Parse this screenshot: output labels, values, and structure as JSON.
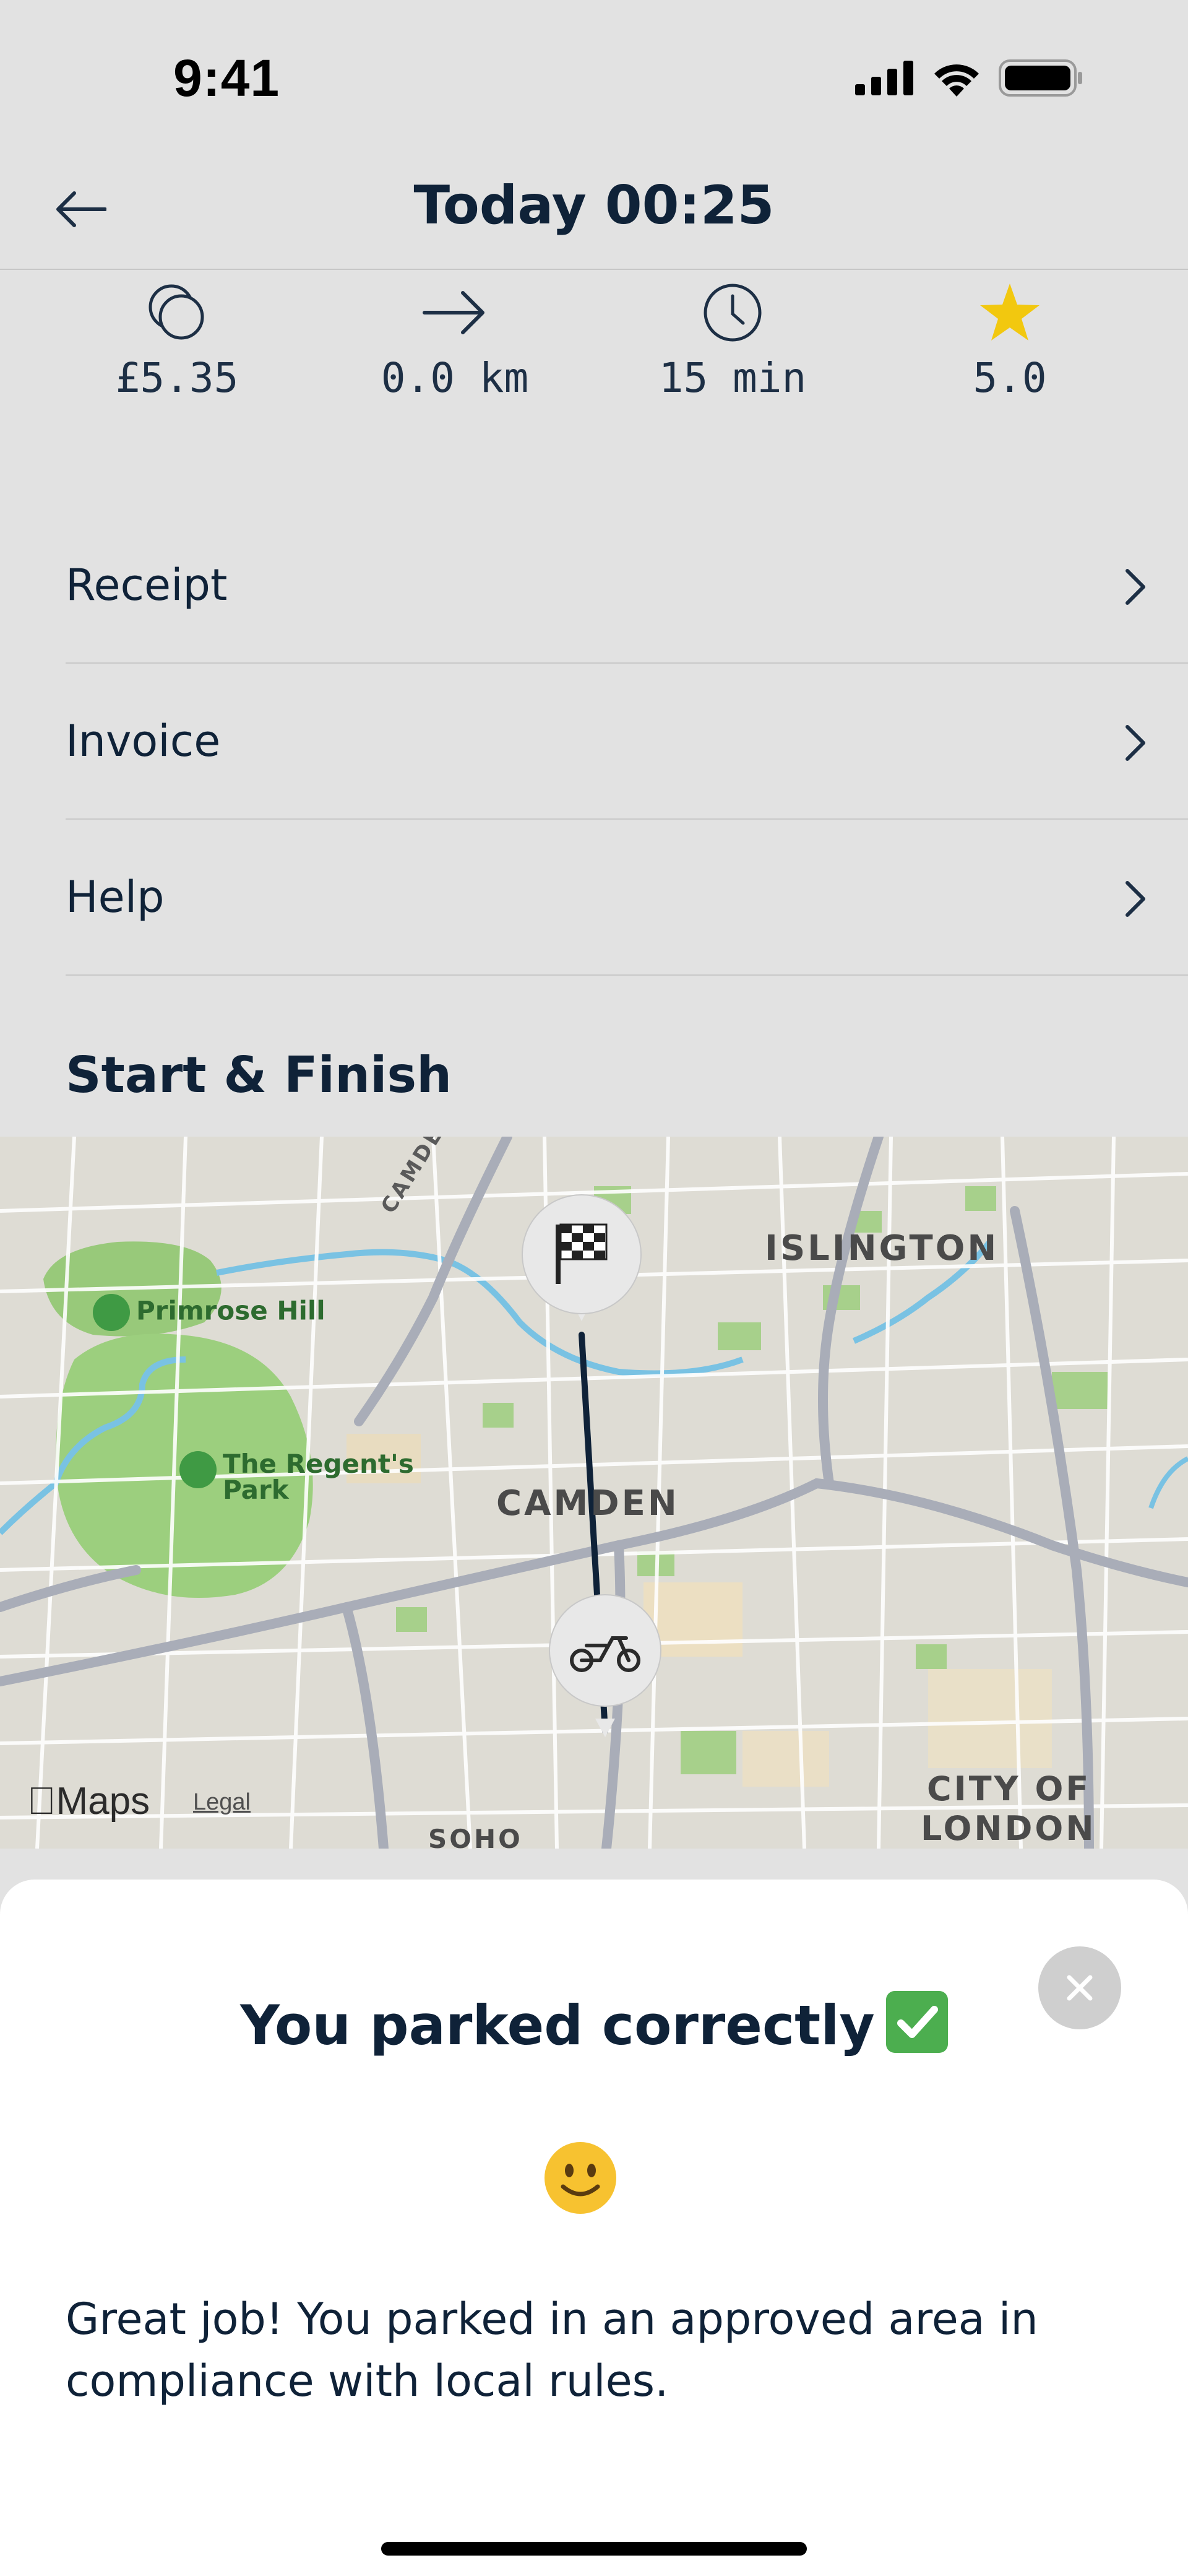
{
  "status_bar": {
    "time": "9:41"
  },
  "header": {
    "title": "Today 00:25"
  },
  "stats": [
    {
      "icon": "coins-icon",
      "value": "£5.35"
    },
    {
      "icon": "arrow-right-icon",
      "value": "0.0 km"
    },
    {
      "icon": "clock-icon",
      "value": "15 min"
    },
    {
      "icon": "star-icon",
      "value": "5.0"
    }
  ],
  "menu": [
    {
      "label": "Receipt"
    },
    {
      "label": "Invoice"
    },
    {
      "label": "Help"
    }
  ],
  "section": {
    "title": "Start & Finish"
  },
  "map": {
    "labels": {
      "islington": "ISLINGTON",
      "camden": "CAMDEN",
      "camden_road": "CAMDEN ROAD",
      "city_of_london_1": "CITY OF",
      "city_of_london_2": "LONDON",
      "soho": "SOHO",
      "primrose_hill": "Primrose Hill",
      "regents_park_1": "The Regent's",
      "regents_park_2": "Park"
    },
    "logo": "Maps",
    "legal": "Legal",
    "start_marker_icon": "scooter-icon",
    "finish_marker_icon": "checkered-flag-icon"
  },
  "sheet": {
    "title": "You parked correctly",
    "body": "Great job! You parked in an approved area in compliance with local rules."
  },
  "colors": {
    "primary_text": "#0f2238",
    "star": "#f2c80f",
    "check": "#4cae4f",
    "route": "#0f2238"
  }
}
